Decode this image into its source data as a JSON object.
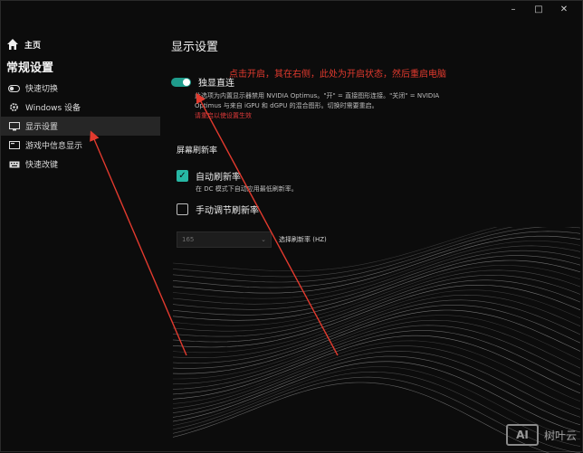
{
  "window_controls": {
    "minimize": "–",
    "maximize": "□",
    "close": "✕"
  },
  "sidebar": {
    "home_label": "主页",
    "section_title": "常规设置",
    "items": [
      {
        "label": "快速切换",
        "icon": "toggle-icon"
      },
      {
        "label": "Windows 设备",
        "icon": "gear-icon"
      },
      {
        "label": "显示设置",
        "icon": "monitor-icon",
        "active": true
      },
      {
        "label": "游戏中信息显示",
        "icon": "display-info-icon"
      },
      {
        "label": "快速改键",
        "icon": "keyboard-icon"
      }
    ]
  },
  "main": {
    "title": "显示设置",
    "dgpu": {
      "label": "独显直连",
      "state": "on",
      "description_1": "此选项为内置显示器禁用 NVIDIA Optimus。\"开\" = 直接图形连接。\"关闭\" = NVIDIA",
      "description_2": "Optimus 与来自 iGPU 和 dGPU 的混合图形。切换时需要重启。",
      "restart_note": "请重启以使设置生效"
    },
    "refresh": {
      "title": "屏幕刷新率",
      "auto_label": "自动刷新率",
      "auto_checked": true,
      "auto_desc": "在 DC 模式下自动应用最低刷新率。",
      "manual_label": "手动调节刷新率",
      "manual_checked": false,
      "rate_value": "165",
      "rate_label": "选择刷新率 (HZ)"
    }
  },
  "annotation": "点击开启，其在右侧，此处为开启状态，然后重启电脑",
  "watermark": {
    "logo": "AI",
    "text": "树叶云"
  },
  "colors": {
    "accent": "#27b7a4",
    "annotation": "#e23a2e",
    "background": "#0c0c0c"
  }
}
